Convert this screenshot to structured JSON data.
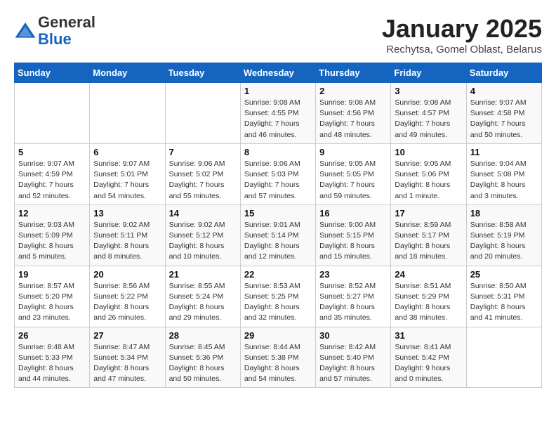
{
  "header": {
    "logo_line1": "General",
    "logo_line2": "Blue",
    "title": "January 2025",
    "subtitle": "Rechytsa, Gomel Oblast, Belarus"
  },
  "weekdays": [
    "Sunday",
    "Monday",
    "Tuesday",
    "Wednesday",
    "Thursday",
    "Friday",
    "Saturday"
  ],
  "weeks": [
    [
      {
        "day": "",
        "info": ""
      },
      {
        "day": "",
        "info": ""
      },
      {
        "day": "",
        "info": ""
      },
      {
        "day": "1",
        "info": "Sunrise: 9:08 AM\nSunset: 4:55 PM\nDaylight: 7 hours and 46 minutes."
      },
      {
        "day": "2",
        "info": "Sunrise: 9:08 AM\nSunset: 4:56 PM\nDaylight: 7 hours and 48 minutes."
      },
      {
        "day": "3",
        "info": "Sunrise: 9:08 AM\nSunset: 4:57 PM\nDaylight: 7 hours and 49 minutes."
      },
      {
        "day": "4",
        "info": "Sunrise: 9:07 AM\nSunset: 4:58 PM\nDaylight: 7 hours and 50 minutes."
      }
    ],
    [
      {
        "day": "5",
        "info": "Sunrise: 9:07 AM\nSunset: 4:59 PM\nDaylight: 7 hours and 52 minutes."
      },
      {
        "day": "6",
        "info": "Sunrise: 9:07 AM\nSunset: 5:01 PM\nDaylight: 7 hours and 54 minutes."
      },
      {
        "day": "7",
        "info": "Sunrise: 9:06 AM\nSunset: 5:02 PM\nDaylight: 7 hours and 55 minutes."
      },
      {
        "day": "8",
        "info": "Sunrise: 9:06 AM\nSunset: 5:03 PM\nDaylight: 7 hours and 57 minutes."
      },
      {
        "day": "9",
        "info": "Sunrise: 9:05 AM\nSunset: 5:05 PM\nDaylight: 7 hours and 59 minutes."
      },
      {
        "day": "10",
        "info": "Sunrise: 9:05 AM\nSunset: 5:06 PM\nDaylight: 8 hours and 1 minute."
      },
      {
        "day": "11",
        "info": "Sunrise: 9:04 AM\nSunset: 5:08 PM\nDaylight: 8 hours and 3 minutes."
      }
    ],
    [
      {
        "day": "12",
        "info": "Sunrise: 9:03 AM\nSunset: 5:09 PM\nDaylight: 8 hours and 5 minutes."
      },
      {
        "day": "13",
        "info": "Sunrise: 9:02 AM\nSunset: 5:11 PM\nDaylight: 8 hours and 8 minutes."
      },
      {
        "day": "14",
        "info": "Sunrise: 9:02 AM\nSunset: 5:12 PM\nDaylight: 8 hours and 10 minutes."
      },
      {
        "day": "15",
        "info": "Sunrise: 9:01 AM\nSunset: 5:14 PM\nDaylight: 8 hours and 12 minutes."
      },
      {
        "day": "16",
        "info": "Sunrise: 9:00 AM\nSunset: 5:15 PM\nDaylight: 8 hours and 15 minutes."
      },
      {
        "day": "17",
        "info": "Sunrise: 8:59 AM\nSunset: 5:17 PM\nDaylight: 8 hours and 18 minutes."
      },
      {
        "day": "18",
        "info": "Sunrise: 8:58 AM\nSunset: 5:19 PM\nDaylight: 8 hours and 20 minutes."
      }
    ],
    [
      {
        "day": "19",
        "info": "Sunrise: 8:57 AM\nSunset: 5:20 PM\nDaylight: 8 hours and 23 minutes."
      },
      {
        "day": "20",
        "info": "Sunrise: 8:56 AM\nSunset: 5:22 PM\nDaylight: 8 hours and 26 minutes."
      },
      {
        "day": "21",
        "info": "Sunrise: 8:55 AM\nSunset: 5:24 PM\nDaylight: 8 hours and 29 minutes."
      },
      {
        "day": "22",
        "info": "Sunrise: 8:53 AM\nSunset: 5:25 PM\nDaylight: 8 hours and 32 minutes."
      },
      {
        "day": "23",
        "info": "Sunrise: 8:52 AM\nSunset: 5:27 PM\nDaylight: 8 hours and 35 minutes."
      },
      {
        "day": "24",
        "info": "Sunrise: 8:51 AM\nSunset: 5:29 PM\nDaylight: 8 hours and 38 minutes."
      },
      {
        "day": "25",
        "info": "Sunrise: 8:50 AM\nSunset: 5:31 PM\nDaylight: 8 hours and 41 minutes."
      }
    ],
    [
      {
        "day": "26",
        "info": "Sunrise: 8:48 AM\nSunset: 5:33 PM\nDaylight: 8 hours and 44 minutes."
      },
      {
        "day": "27",
        "info": "Sunrise: 8:47 AM\nSunset: 5:34 PM\nDaylight: 8 hours and 47 minutes."
      },
      {
        "day": "28",
        "info": "Sunrise: 8:45 AM\nSunset: 5:36 PM\nDaylight: 8 hours and 50 minutes."
      },
      {
        "day": "29",
        "info": "Sunrise: 8:44 AM\nSunset: 5:38 PM\nDaylight: 8 hours and 54 minutes."
      },
      {
        "day": "30",
        "info": "Sunrise: 8:42 AM\nSunset: 5:40 PM\nDaylight: 8 hours and 57 minutes."
      },
      {
        "day": "31",
        "info": "Sunrise: 8:41 AM\nSunset: 5:42 PM\nDaylight: 9 hours and 0 minutes."
      },
      {
        "day": "",
        "info": ""
      }
    ]
  ]
}
